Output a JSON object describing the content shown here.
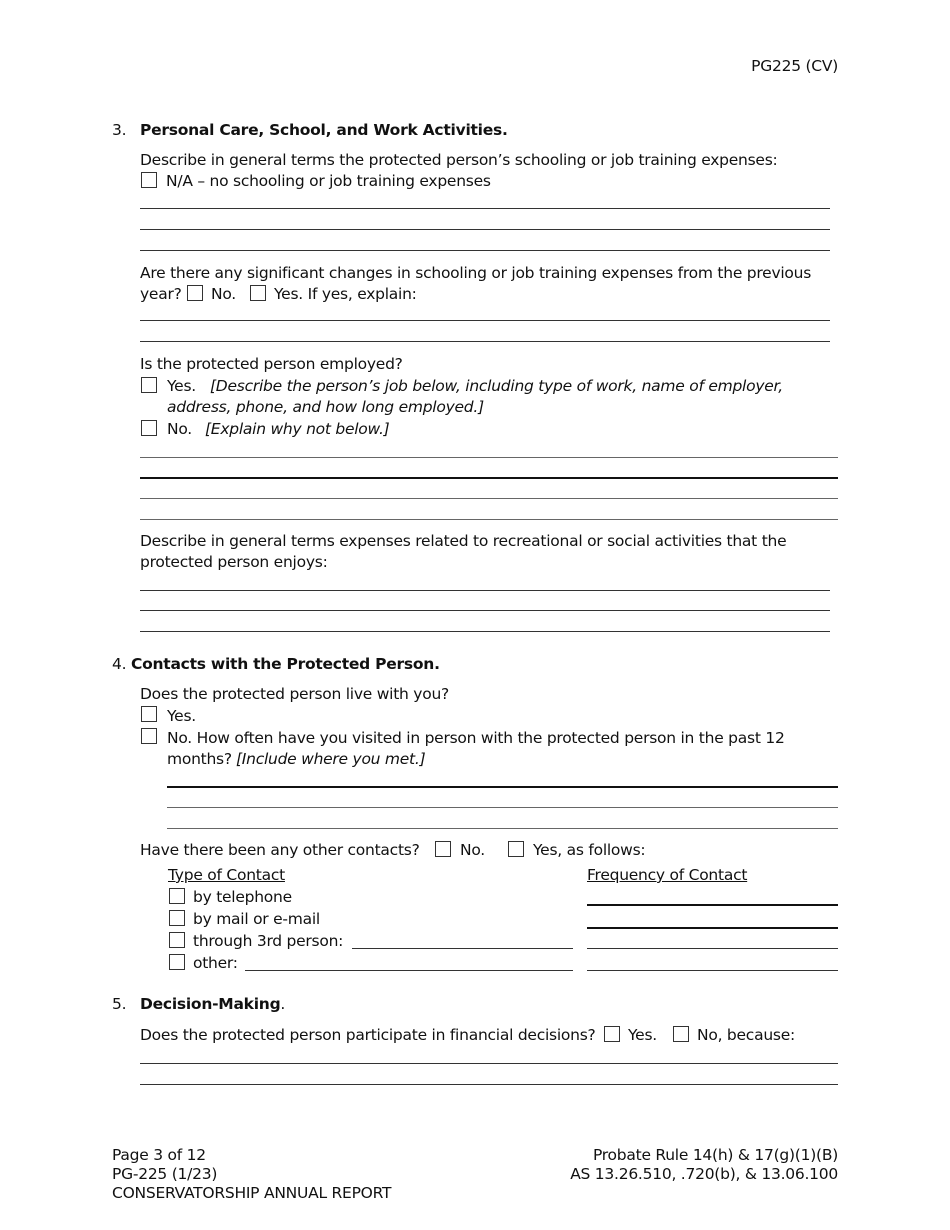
{
  "header": {
    "form_code": "PG225 (CV)"
  },
  "section3": {
    "number": "3.",
    "title": "Personal Care, School, and Work Activities.",
    "schooling_prompt": "Describe in general terms the protected person’s schooling or job training expenses:",
    "na_option": "N/A – no schooling or job training expenses",
    "changes_prompt_line1": "Are there any significant changes in schooling or job training expenses from the previous",
    "changes_prompt_year": "year?",
    "changes_no": "No.",
    "changes_yes": "Yes.  If yes, explain:",
    "employed_prompt": "Is the protected person employed?",
    "employed_yes": "Yes.",
    "employed_yes_instr_line1": "[Describe the person’s job below, including type of work, name of employer,",
    "employed_yes_instr_line2": "address, phone, and how long employed.]",
    "employed_no": "No.",
    "employed_no_instr": "[Explain why not below.]",
    "recreation_prompt_line1": "Describe in general terms expenses related to recreational or social activities that the",
    "recreation_prompt_line2": "protected person enjoys:"
  },
  "section4": {
    "number": "4.",
    "title": "Contacts with the Protected Person.",
    "live_prompt": "Does the protected person live with you?",
    "live_yes": "Yes.",
    "live_no_line1": "No.  How often have you visited in person with the protected person in the past 12",
    "live_no_line2": "months?",
    "live_no_instr": "[Include where you met.]",
    "other_contacts_prompt": "Have there been any other contacts?",
    "other_no": "No.",
    "other_yes": "Yes, as follows:",
    "col_type": "Type of Contact",
    "col_frequency": "Frequency of Contact",
    "contact_types": [
      {
        "label": "by telephone"
      },
      {
        "label": "by mail or e-mail"
      },
      {
        "label": "through 3rd person:"
      },
      {
        "label": "other:"
      }
    ]
  },
  "section5": {
    "number": "5.",
    "title": "Decision-Making",
    "title_period": ".",
    "financial_prompt": "Does the protected person participate in financial decisions?",
    "financial_yes": "Yes.",
    "financial_no": "No, because:"
  },
  "footer": {
    "page": "Page 3 of 12",
    "form_version": "PG-225 (1/23)",
    "form_name": "CONSERVATORSHIP ANNUAL REPORT",
    "rule": "Probate Rule 14(h) & 17(g)(1)(B)",
    "statutes": "AS 13.26.510, .720(b), & 13.06.100"
  }
}
